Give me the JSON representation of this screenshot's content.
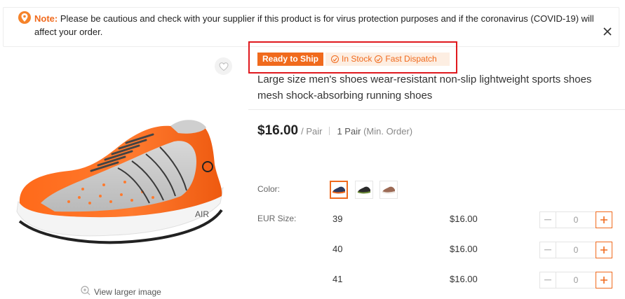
{
  "notice": {
    "label": "Note:",
    "message": "Please be cautious and check with your supplier if this product is for virus protection purposes and if the coronavirus (COVID-19) will affect your order.",
    "icon": "location-pin-icon",
    "close_icon": "close-icon"
  },
  "gallery": {
    "view_larger": "View larger image",
    "favorite_icon": "heart-icon",
    "zoom_icon": "zoom-in-icon"
  },
  "badges": {
    "ready": "Ready to Ship",
    "in_stock": "In Stock",
    "fast_dispatch": "Fast Dispatch"
  },
  "product": {
    "title": "Large size men's shoes wear-resistant non-slip lightweight sports shoes mesh shock-absorbing running shoes",
    "price": "$16.00",
    "price_unit": "/ Pair",
    "min_order_qty": "1 Pair",
    "min_order_label": "(Min. Order)"
  },
  "color": {
    "label": "Color:",
    "swatches": [
      {
        "name": "navy-orange",
        "selected": true
      },
      {
        "name": "black-green",
        "selected": false
      },
      {
        "name": "brown-orange",
        "selected": false
      }
    ]
  },
  "sizes": {
    "label": "EUR Size:",
    "rows": [
      {
        "size": "39",
        "price": "$16.00",
        "qty": "0"
      },
      {
        "size": "40",
        "price": "$16.00",
        "qty": "0"
      },
      {
        "size": "41",
        "price": "$16.00",
        "qty": "0"
      }
    ]
  },
  "colors": {
    "accent": "#f06a1d",
    "highlight_border": "#e0191e"
  }
}
